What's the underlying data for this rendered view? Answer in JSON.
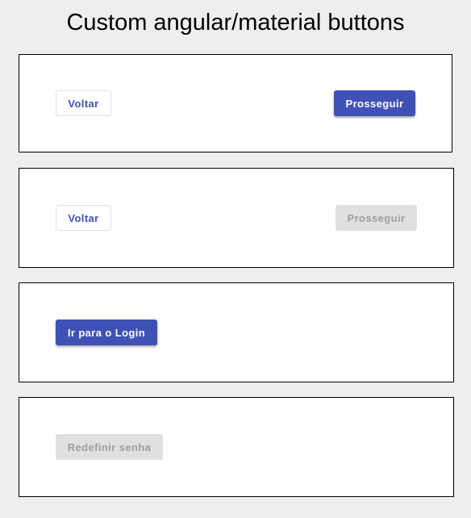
{
  "page": {
    "title": "Custom angular/material buttons"
  },
  "colors": {
    "primary": "#3f51b5",
    "disabled_bg": "#e0e0e0",
    "disabled_text": "#9e9e9e",
    "page_bg": "#eeeeee"
  },
  "cards": [
    {
      "back_label": "Voltar",
      "next_label": "Prosseguir",
      "next_state": "enabled"
    },
    {
      "back_label": "Voltar",
      "next_label": "Prosseguir",
      "next_state": "disabled"
    },
    {
      "login_label": "Ir para o Login",
      "login_state": "enabled"
    },
    {
      "reset_label": "Redefinir senha",
      "reset_state": "disabled"
    }
  ]
}
